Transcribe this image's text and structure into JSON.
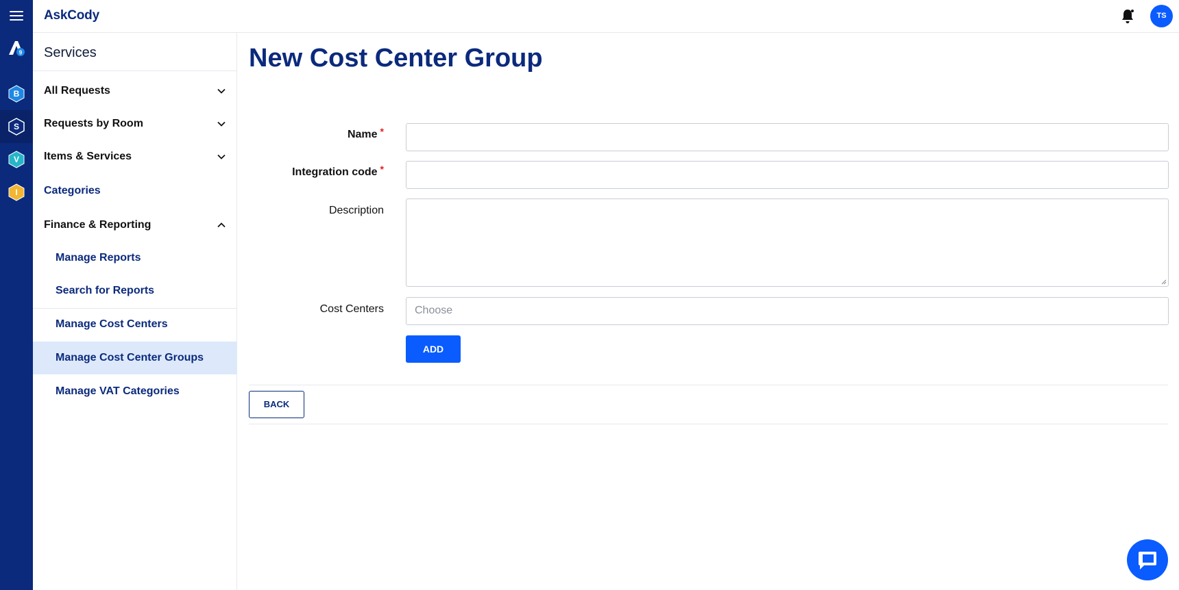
{
  "app": {
    "brand": "AskCody",
    "avatar_initials": "TS",
    "accent": "#0a5cff",
    "brand_color": "#0b2a7c",
    "rail_color": "#0b2a7c"
  },
  "rail": {
    "items": [
      {
        "letter": "B",
        "color": "#1e88e5"
      },
      {
        "letter": "S",
        "color": "#0b2a7c"
      },
      {
        "letter": "V",
        "color": "#26b5c9"
      },
      {
        "letter": "I",
        "color": "#f2b632"
      }
    ]
  },
  "sidebar": {
    "title": "Services",
    "items": [
      {
        "label": "All Requests",
        "chevron": "down"
      },
      {
        "label": "Requests by Room",
        "chevron": "down"
      },
      {
        "label": "Items & Services",
        "chevron": "down"
      },
      {
        "label": "Categories"
      },
      {
        "label": "Finance & Reporting",
        "chevron": "up"
      }
    ],
    "sub_items": [
      {
        "label": "Manage Reports"
      },
      {
        "label": "Search for Reports"
      },
      {
        "label": "Manage Cost Centers"
      },
      {
        "label": "Manage Cost Center Groups",
        "active": true
      },
      {
        "label": "Manage VAT Categories"
      }
    ]
  },
  "main": {
    "title": "New Cost Center Group",
    "form": {
      "name_label": "Name",
      "name_value": "",
      "integration_label": "Integration code",
      "integration_value": "",
      "description_label": "Description",
      "description_value": "",
      "cost_centers_label": "Cost Centers",
      "cost_centers_placeholder": "Choose",
      "required_mark": "*"
    },
    "add_label": "ADD",
    "back_label": "BACK"
  }
}
